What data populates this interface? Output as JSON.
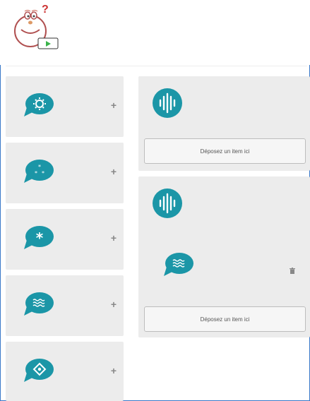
{
  "colors": {
    "accent": "#1b96a7",
    "panel": "#ececec",
    "border": "#3a78c8"
  },
  "palette": {
    "items": [
      {
        "icon": "gear-bubble-icon"
      },
      {
        "icon": "dots-bubble-icon"
      },
      {
        "icon": "asterisk-bubble-icon"
      },
      {
        "icon": "waves-bubble-icon"
      },
      {
        "icon": "diamond-bubble-icon"
      }
    ],
    "plus_label": "+"
  },
  "zones": [
    {
      "icon": "sound-wave-icon",
      "drop_label": "Déposez un item ici",
      "items": []
    },
    {
      "icon": "sound-wave-icon",
      "drop_label": "Déposez un item ici",
      "items": [
        {
          "icon": "waves-bubble-icon"
        }
      ]
    }
  ]
}
